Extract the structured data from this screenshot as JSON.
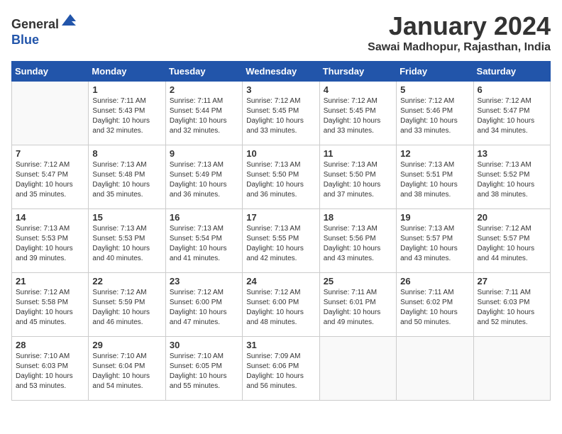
{
  "header": {
    "logo_line1": "General",
    "logo_line2": "Blue",
    "title": "January 2024",
    "subtitle": "Sawai Madhopur, Rajasthan, India"
  },
  "weekdays": [
    "Sunday",
    "Monday",
    "Tuesday",
    "Wednesday",
    "Thursday",
    "Friday",
    "Saturday"
  ],
  "weeks": [
    [
      {
        "day": "",
        "info": ""
      },
      {
        "day": "1",
        "info": "Sunrise: 7:11 AM\nSunset: 5:43 PM\nDaylight: 10 hours\nand 32 minutes."
      },
      {
        "day": "2",
        "info": "Sunrise: 7:11 AM\nSunset: 5:44 PM\nDaylight: 10 hours\nand 32 minutes."
      },
      {
        "day": "3",
        "info": "Sunrise: 7:12 AM\nSunset: 5:45 PM\nDaylight: 10 hours\nand 33 minutes."
      },
      {
        "day": "4",
        "info": "Sunrise: 7:12 AM\nSunset: 5:45 PM\nDaylight: 10 hours\nand 33 minutes."
      },
      {
        "day": "5",
        "info": "Sunrise: 7:12 AM\nSunset: 5:46 PM\nDaylight: 10 hours\nand 33 minutes."
      },
      {
        "day": "6",
        "info": "Sunrise: 7:12 AM\nSunset: 5:47 PM\nDaylight: 10 hours\nand 34 minutes."
      }
    ],
    [
      {
        "day": "7",
        "info": "Sunrise: 7:12 AM\nSunset: 5:47 PM\nDaylight: 10 hours\nand 35 minutes."
      },
      {
        "day": "8",
        "info": "Sunrise: 7:13 AM\nSunset: 5:48 PM\nDaylight: 10 hours\nand 35 minutes."
      },
      {
        "day": "9",
        "info": "Sunrise: 7:13 AM\nSunset: 5:49 PM\nDaylight: 10 hours\nand 36 minutes."
      },
      {
        "day": "10",
        "info": "Sunrise: 7:13 AM\nSunset: 5:50 PM\nDaylight: 10 hours\nand 36 minutes."
      },
      {
        "day": "11",
        "info": "Sunrise: 7:13 AM\nSunset: 5:50 PM\nDaylight: 10 hours\nand 37 minutes."
      },
      {
        "day": "12",
        "info": "Sunrise: 7:13 AM\nSunset: 5:51 PM\nDaylight: 10 hours\nand 38 minutes."
      },
      {
        "day": "13",
        "info": "Sunrise: 7:13 AM\nSunset: 5:52 PM\nDaylight: 10 hours\nand 38 minutes."
      }
    ],
    [
      {
        "day": "14",
        "info": "Sunrise: 7:13 AM\nSunset: 5:53 PM\nDaylight: 10 hours\nand 39 minutes."
      },
      {
        "day": "15",
        "info": "Sunrise: 7:13 AM\nSunset: 5:53 PM\nDaylight: 10 hours\nand 40 minutes."
      },
      {
        "day": "16",
        "info": "Sunrise: 7:13 AM\nSunset: 5:54 PM\nDaylight: 10 hours\nand 41 minutes."
      },
      {
        "day": "17",
        "info": "Sunrise: 7:13 AM\nSunset: 5:55 PM\nDaylight: 10 hours\nand 42 minutes."
      },
      {
        "day": "18",
        "info": "Sunrise: 7:13 AM\nSunset: 5:56 PM\nDaylight: 10 hours\nand 43 minutes."
      },
      {
        "day": "19",
        "info": "Sunrise: 7:13 AM\nSunset: 5:57 PM\nDaylight: 10 hours\nand 43 minutes."
      },
      {
        "day": "20",
        "info": "Sunrise: 7:12 AM\nSunset: 5:57 PM\nDaylight: 10 hours\nand 44 minutes."
      }
    ],
    [
      {
        "day": "21",
        "info": "Sunrise: 7:12 AM\nSunset: 5:58 PM\nDaylight: 10 hours\nand 45 minutes."
      },
      {
        "day": "22",
        "info": "Sunrise: 7:12 AM\nSunset: 5:59 PM\nDaylight: 10 hours\nand 46 minutes."
      },
      {
        "day": "23",
        "info": "Sunrise: 7:12 AM\nSunset: 6:00 PM\nDaylight: 10 hours\nand 47 minutes."
      },
      {
        "day": "24",
        "info": "Sunrise: 7:12 AM\nSunset: 6:00 PM\nDaylight: 10 hours\nand 48 minutes."
      },
      {
        "day": "25",
        "info": "Sunrise: 7:11 AM\nSunset: 6:01 PM\nDaylight: 10 hours\nand 49 minutes."
      },
      {
        "day": "26",
        "info": "Sunrise: 7:11 AM\nSunset: 6:02 PM\nDaylight: 10 hours\nand 50 minutes."
      },
      {
        "day": "27",
        "info": "Sunrise: 7:11 AM\nSunset: 6:03 PM\nDaylight: 10 hours\nand 52 minutes."
      }
    ],
    [
      {
        "day": "28",
        "info": "Sunrise: 7:10 AM\nSunset: 6:03 PM\nDaylight: 10 hours\nand 53 minutes."
      },
      {
        "day": "29",
        "info": "Sunrise: 7:10 AM\nSunset: 6:04 PM\nDaylight: 10 hours\nand 54 minutes."
      },
      {
        "day": "30",
        "info": "Sunrise: 7:10 AM\nSunset: 6:05 PM\nDaylight: 10 hours\nand 55 minutes."
      },
      {
        "day": "31",
        "info": "Sunrise: 7:09 AM\nSunset: 6:06 PM\nDaylight: 10 hours\nand 56 minutes."
      },
      {
        "day": "",
        "info": ""
      },
      {
        "day": "",
        "info": ""
      },
      {
        "day": "",
        "info": ""
      }
    ]
  ]
}
